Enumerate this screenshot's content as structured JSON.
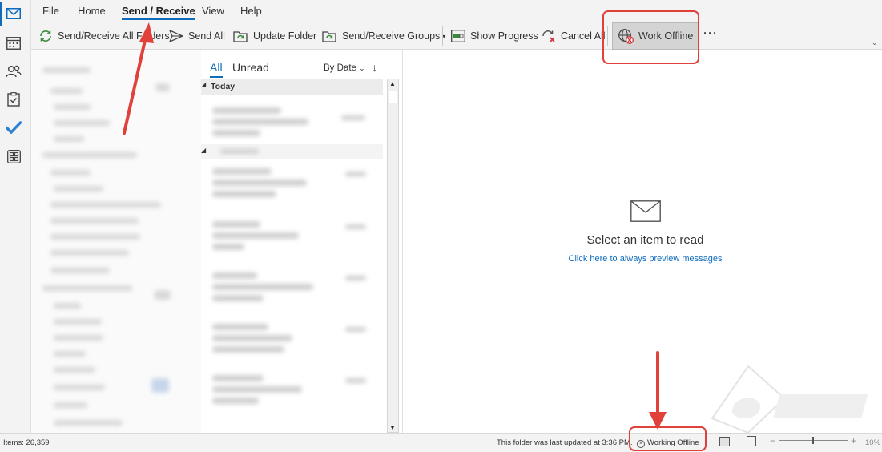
{
  "menu": {
    "tabs": [
      "File",
      "Home",
      "Send / Receive",
      "View",
      "Help"
    ],
    "active_tab": "Send / Receive"
  },
  "ribbon": {
    "send_receive_all": "Send/Receive All Folders",
    "send_all": "Send All",
    "update_folder": "Update Folder",
    "send_receive_groups": "Send/Receive Groups",
    "show_progress": "Show Progress",
    "cancel_all": "Cancel All",
    "work_offline": "Work Offline",
    "more": "⋯"
  },
  "message_list": {
    "filter_all": "All",
    "filter_unread": "Unread",
    "sort": "By Date",
    "group_today": "Today"
  },
  "reading_pane": {
    "title": "Select an item to read",
    "link": "Click here to always preview messages"
  },
  "status_bar": {
    "items": "Items: 26,359",
    "last_updated": "This folder was last updated at 3:36 PM.",
    "working_offline": "Working Offline",
    "zoom": "10%"
  },
  "colors": {
    "accent": "#0f6cbd",
    "annotation": "#e0413a"
  },
  "icons": [
    "mail-icon",
    "calendar-icon",
    "people-icon",
    "tasks-icon",
    "todo-icon",
    "apps-icon"
  ]
}
